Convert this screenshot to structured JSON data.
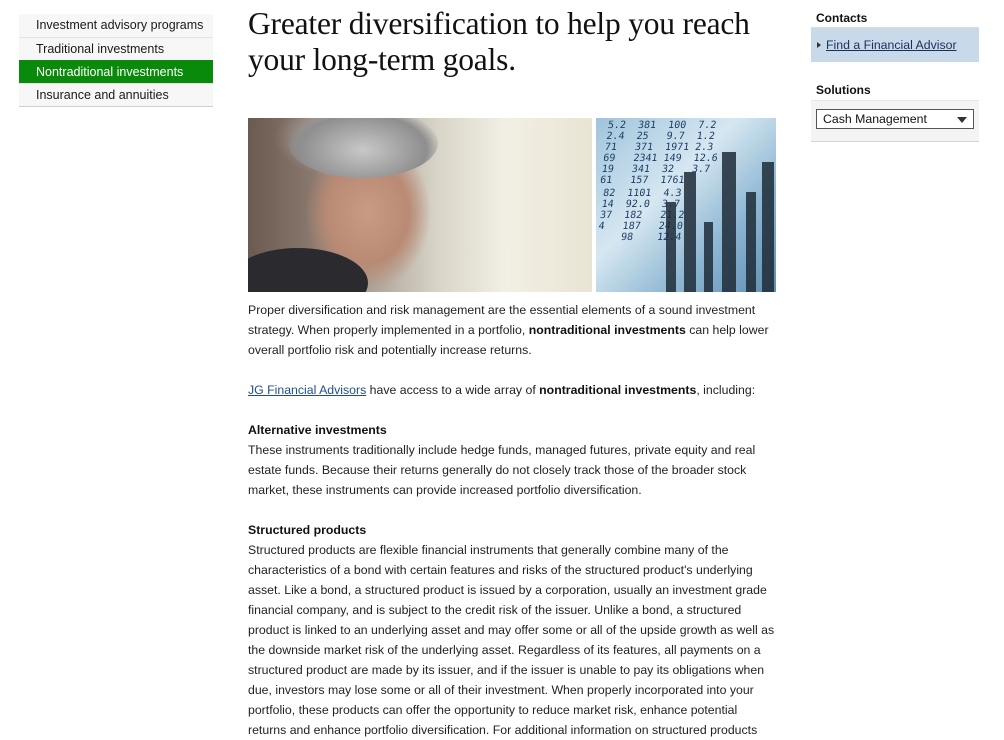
{
  "left_nav": {
    "items": [
      {
        "label": "Investment advisory programs",
        "active": false
      },
      {
        "label": "Traditional investments",
        "active": false
      },
      {
        "label": "Nontraditional investments",
        "active": true
      },
      {
        "label": "Insurance and annuities",
        "active": false
      }
    ]
  },
  "main": {
    "headline": "Greater diversification to help you reach your long-term goals.",
    "intro": {
      "part1": "Proper diversification and risk management are the essential elements of a sound investment strategy. When properly implemented in a portfolio, ",
      "bold": "nontraditional investments",
      "part2": " can help lower overall portfolio risk and potentially increase returns."
    },
    "access": {
      "link": "JG Financial Advisors",
      "part1": " have access to a wide array of ",
      "bold": "nontraditional investments",
      "part2": ", including:"
    },
    "alternative": {
      "heading": "Alternative investments",
      "text": "These instruments traditionally include hedge funds, managed futures, private equity and real estate funds. Because their returns generally do not closely track those of the broader stock market, these instruments can provide increased portfolio diversification."
    },
    "structured": {
      "heading": "Structured products",
      "text": "Structured products are flexible financial instruments that generally combine many of the characteristics of a bond with certain features and risks of the structured product's underlying asset. Like a bond, a structured product is issued by a corporation, usually an investment grade financial company, and is subject to the credit risk of the issuer. Unlike a bond, a structured product is linked to an underlying asset and may offer some or all of the upside growth as well as the downside market risk of the underlying asset. Regardless of its features, all payments on a structured product are made by its issuer, and if the issuer is unable to pay its obligations when due, investors may lose some or all of their investment. When properly incorporated into your portfolio, these products can offer the opportunity to reduce market risk, enhance potential returns and enhance portfolio diversification. For additional information on structured products"
    }
  },
  "right": {
    "contacts_title": "Contacts",
    "contacts_link": "Find a Financial Advisor",
    "solutions_title": "Solutions",
    "solutions_selected": "Cash Management"
  },
  "colors": {
    "nav_active": "#0a8a0a",
    "contacts_box": "#c8d9ea",
    "link": "#1f4e8c"
  }
}
